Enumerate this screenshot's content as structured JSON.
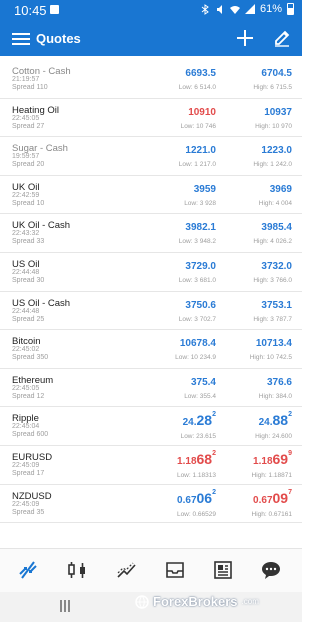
{
  "status": {
    "time": "10:45",
    "battery": "61%"
  },
  "header": {
    "title": "Quotes",
    "background": "#1976d2"
  },
  "quotes": [
    {
      "symbol": "Cotton - Cash",
      "time": "21:19:57",
      "spread": "Spread 110",
      "bid_main": "6693.5",
      "bid_big": "",
      "bid_sup": "",
      "ask_main": "6704.5",
      "ask_big": "",
      "ask_sup": "",
      "low": "Low: 6 514.0",
      "high": "High: 6 715.5",
      "bid_color": "blue",
      "ask_color": "blue",
      "dim": true
    },
    {
      "symbol": "Heating Oil",
      "time": "22:45:05",
      "spread": "Spread 27",
      "bid_main": "10910",
      "bid_big": "",
      "bid_sup": "",
      "ask_main": "10937",
      "ask_big": "",
      "ask_sup": "",
      "low": "Low: 10 746",
      "high": "High: 10 970",
      "bid_color": "red",
      "ask_color": "blue",
      "dim": false
    },
    {
      "symbol": "Sugar - Cash",
      "time": "19:59:57",
      "spread": "Spread 20",
      "bid_main": "1221.0",
      "bid_big": "",
      "bid_sup": "",
      "ask_main": "1223.0",
      "ask_big": "",
      "ask_sup": "",
      "low": "Low: 1 217.0",
      "high": "High: 1 242.0",
      "bid_color": "blue",
      "ask_color": "blue",
      "dim": true
    },
    {
      "symbol": "UK Oil",
      "time": "22:42:59",
      "spread": "Spread 10",
      "bid_main": "3959",
      "bid_big": "",
      "bid_sup": "",
      "ask_main": "3969",
      "ask_big": "",
      "ask_sup": "",
      "low": "Low: 3 928",
      "high": "High: 4 004",
      "bid_color": "blue",
      "ask_color": "blue",
      "dim": false
    },
    {
      "symbol": "UK Oil - Cash",
      "time": "22:43:32",
      "spread": "Spread 33",
      "bid_main": "3982.1",
      "bid_big": "",
      "bid_sup": "",
      "ask_main": "3985.4",
      "ask_big": "",
      "ask_sup": "",
      "low": "Low: 3 948.2",
      "high": "High: 4 026.2",
      "bid_color": "blue",
      "ask_color": "blue",
      "dim": false
    },
    {
      "symbol": "US Oil",
      "time": "22:44:48",
      "spread": "Spread 30",
      "bid_main": "3729.0",
      "bid_big": "",
      "bid_sup": "",
      "ask_main": "3732.0",
      "ask_big": "",
      "ask_sup": "",
      "low": "Low: 3 681.0",
      "high": "High: 3 766.0",
      "bid_color": "blue",
      "ask_color": "blue",
      "dim": false
    },
    {
      "symbol": "US Oil - Cash",
      "time": "22:44:48",
      "spread": "Spread 25",
      "bid_main": "3750.6",
      "bid_big": "",
      "bid_sup": "",
      "ask_main": "3753.1",
      "ask_big": "",
      "ask_sup": "",
      "low": "Low: 3 702.7",
      "high": "High: 3 787.7",
      "bid_color": "blue",
      "ask_color": "blue",
      "dim": false
    },
    {
      "symbol": "Bitcoin",
      "time": "22:45:02",
      "spread": "Spread 350",
      "bid_main": "10678.4",
      "bid_big": "",
      "bid_sup": "",
      "ask_main": "10713.4",
      "ask_big": "",
      "ask_sup": "",
      "low": "Low: 10 234.9",
      "high": "High: 10 742.5",
      "bid_color": "blue",
      "ask_color": "blue",
      "dim": false
    },
    {
      "symbol": "Ethereum",
      "time": "22:45:05",
      "spread": "Spread 12",
      "bid_main": "375.4",
      "bid_big": "",
      "bid_sup": "",
      "ask_main": "376.6",
      "ask_big": "",
      "ask_sup": "",
      "low": "Low: 355.4",
      "high": "High: 384.0",
      "bid_color": "blue",
      "ask_color": "blue",
      "dim": false
    },
    {
      "symbol": "Ripple",
      "time": "22:45:04",
      "spread": "Spread 600",
      "bid_main": "24.",
      "bid_big": "28",
      "bid_sup": "2",
      "ask_main": "24.",
      "ask_big": "88",
      "ask_sup": "2",
      "low": "Low: 23.615",
      "high": "High: 24.600",
      "bid_color": "blue",
      "ask_color": "blue",
      "dim": false
    },
    {
      "symbol": "EURUSD",
      "time": "22:45:09",
      "spread": "Spread 17",
      "bid_main": "1.18",
      "bid_big": "68",
      "bid_sup": "2",
      "ask_main": "1.18",
      "ask_big": "69",
      "ask_sup": "9",
      "low": "Low: 1.18313",
      "high": "High: 1.18871",
      "bid_color": "red",
      "ask_color": "red",
      "dim": false
    },
    {
      "symbol": "NZDUSD",
      "time": "22:45:09",
      "spread": "Spread 35",
      "bid_main": "0.67",
      "bid_big": "06",
      "bid_sup": "2",
      "ask_main": "0.67",
      "ask_big": "09",
      "ask_sup": "7",
      "low": "Low: 0.66529",
      "high": "High: 0.67161",
      "bid_color": "blue",
      "ask_color": "red",
      "dim": false
    }
  ],
  "bottom_nav": [
    {
      "icon": "quotes-icon",
      "active": true
    },
    {
      "icon": "candlestick-chart-icon",
      "active": false
    },
    {
      "icon": "trade-icon",
      "active": false
    },
    {
      "icon": "inbox-icon",
      "active": false
    },
    {
      "icon": "news-icon",
      "active": false
    },
    {
      "icon": "chat-icon",
      "active": false
    }
  ],
  "watermark": {
    "brand": "ForexBrokers",
    "domain": ".com"
  }
}
